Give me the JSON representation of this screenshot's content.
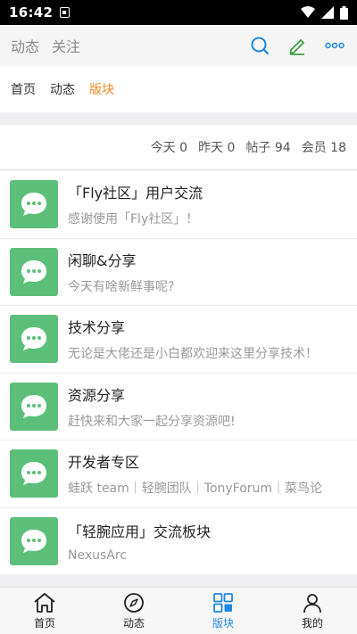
{
  "status_bar": {
    "time": "16:42"
  },
  "header": {
    "tabs": [
      "动态",
      "关注"
    ],
    "actions": [
      {
        "icon": "search-icon",
        "color": "#1e88e5"
      },
      {
        "icon": "edit-icon",
        "color": "#43a047"
      },
      {
        "icon": "more-icon",
        "color": "#1e88e5"
      }
    ]
  },
  "breadcrumb": {
    "items": [
      "首页",
      "动态",
      "版块"
    ],
    "active_index": 2,
    "active_color": "#f08a24"
  },
  "stats": [
    {
      "label": "今天",
      "value": "0"
    },
    {
      "label": "昨天",
      "value": "0"
    },
    {
      "label": "帖子",
      "value": "94"
    },
    {
      "label": "会员",
      "value": "18"
    }
  ],
  "forums": [
    {
      "name": "「Fly社区」用户交流",
      "description": "感谢使用「Fly社区」！",
      "icon": "chat-bubble-icon"
    },
    {
      "name": "闲聊&分享",
      "description": "今天有啥新鲜事呢?",
      "icon": "chat-bubble-icon"
    },
    {
      "name": "技术分享",
      "description": "无论是大佬还是小白都欢迎来这里分享技术！",
      "icon": "chat-bubble-icon"
    },
    {
      "name": "资源分享",
      "description": "赶快来和大家一起分享资源吧!",
      "icon": "chat-bubble-icon"
    },
    {
      "name": "开发者专区",
      "description": "蛙跃 team｜轻腕团队｜TonyForum｜菜鸟论",
      "icon": "chat-bubble-icon"
    },
    {
      "name": "「轻腕应用」交流板块",
      "description": "NexusArc",
      "icon": "chat-bubble-icon"
    }
  ],
  "bottom_nav": {
    "items": [
      {
        "label": "首页",
        "icon": "home-icon"
      },
      {
        "label": "动态",
        "icon": "compass-icon"
      },
      {
        "label": "版块",
        "icon": "grid-icon"
      },
      {
        "label": "我的",
        "icon": "user-icon"
      }
    ],
    "active_index": 2,
    "active_color": "#1e88e5"
  },
  "colors": {
    "forum_icon_bg": "#5bbf7a"
  }
}
